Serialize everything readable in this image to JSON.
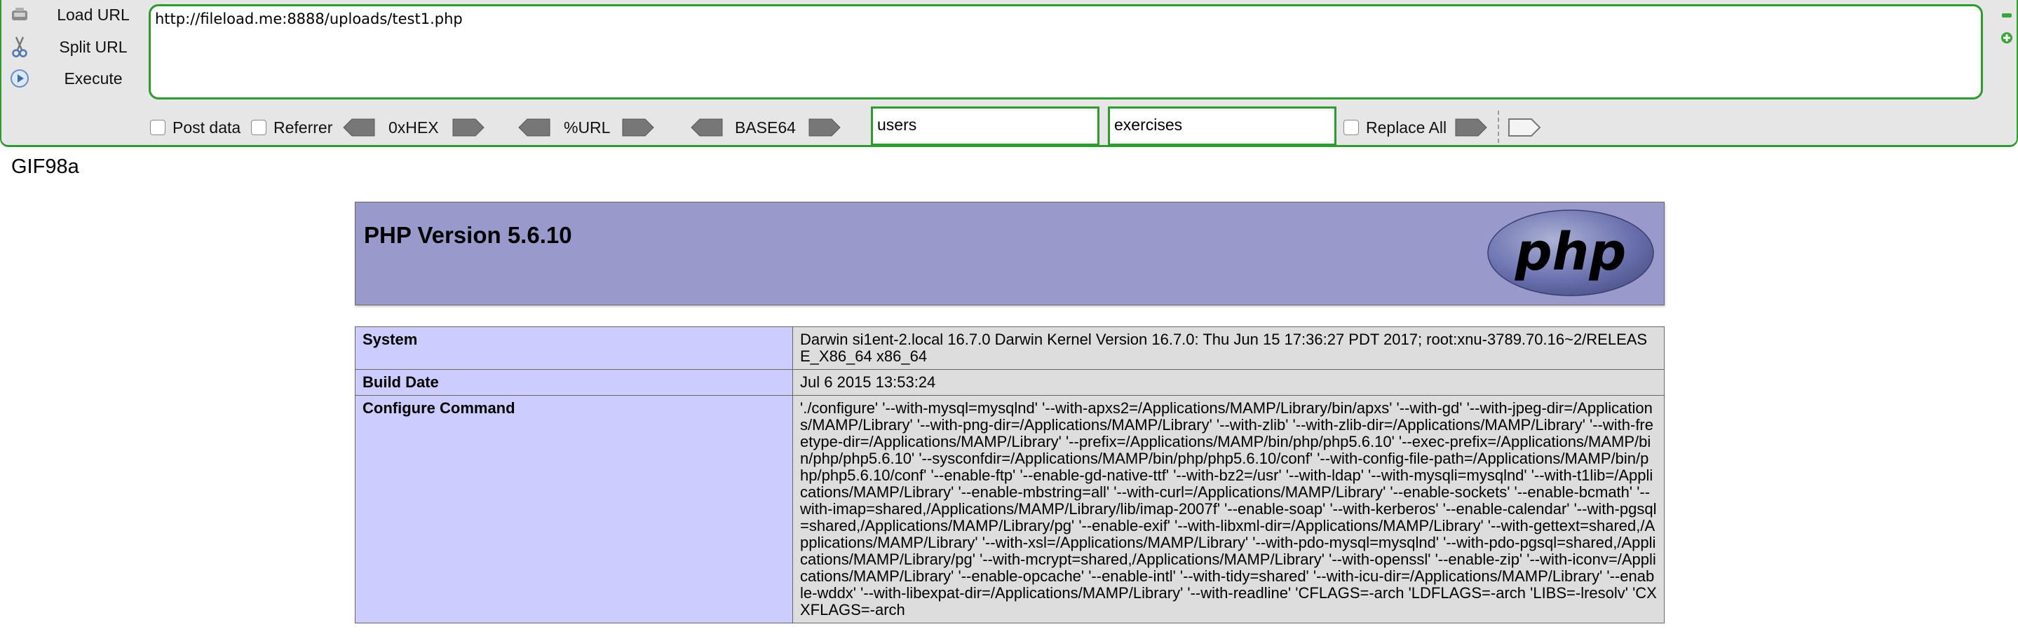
{
  "hackbar": {
    "load_url_label": "Load URL",
    "split_url_label": "Split URL",
    "execute_label": "Execute",
    "url_value": "http://fileload.me:8888/uploads/test1.php",
    "post_data_label": "Post data",
    "referrer_label": "Referrer",
    "hex_label": "0xHEX",
    "url_enc_label": "%URL",
    "base64_label": "BASE64",
    "replace_find_value": "users",
    "replace_with_value": "exercises",
    "replace_all_label": "Replace All",
    "accent_color": "#2f9a30"
  },
  "page": {
    "gif_header": "GIF98a",
    "php_title": "PHP Version 5.6.10",
    "logo_text": "php",
    "rows": [
      {
        "key": "System",
        "value": "Darwin si1ent-2.local 16.7.0 Darwin Kernel Version 16.7.0: Thu Jun 15 17:36:27 PDT 2017; root:xnu-3789.70.16~2/RELEASE_X86_64 x86_64"
      },
      {
        "key": "Build Date",
        "value": "Jul 6 2015 13:53:24"
      },
      {
        "key": "Configure Command",
        "value": "'./configure' '--with-mysql=mysqlnd' '--with-apxs2=/Applications/MAMP/Library/bin/apxs' '--with-gd' '--with-jpeg-dir=/Applications/MAMP/Library' '--with-png-dir=/Applications/MAMP/Library' '--with-zlib' '--with-zlib-dir=/Applications/MAMP/Library' '--with-freetype-dir=/Applications/MAMP/Library' '--prefix=/Applications/MAMP/bin/php/php5.6.10' '--exec-prefix=/Applications/MAMP/bin/php/php5.6.10' '--sysconfdir=/Applications/MAMP/bin/php/php5.6.10/conf' '--with-config-file-path=/Applications/MAMP/bin/php/php5.6.10/conf' '--enable-ftp' '--enable-gd-native-ttf' '--with-bz2=/usr' '--with-ldap' '--with-mysqli=mysqlnd' '--with-t1lib=/Applications/MAMP/Library' '--enable-mbstring=all' '--with-curl=/Applications/MAMP/Library' '--enable-sockets' '--enable-bcmath' '--with-imap=shared,/Applications/MAMP/Library/lib/imap-2007f' '--enable-soap' '--with-kerberos' '--enable-calendar' '--with-pgsql=shared,/Applications/MAMP/Library/pg' '--enable-exif' '--with-libxml-dir=/Applications/MAMP/Library' '--with-gettext=shared,/Applications/MAMP/Library' '--with-xsl=/Applications/MAMP/Library' '--with-pdo-mysql=mysqlnd' '--with-pdo-pgsql=shared,/Applications/MAMP/Library/pg' '--with-mcrypt=shared,/Applications/MAMP/Library' '--with-openssl' '--enable-zip' '--with-iconv=/Applications/MAMP/Library' '--enable-opcache' '--enable-intl' '--with-tidy=shared' '--with-icu-dir=/Applications/MAMP/Library' '--enable-wddx' '--with-libexpat-dir=/Applications/MAMP/Library' '--with-readline' 'CFLAGS=-arch 'LDFLAGS=-arch 'LIBS=-lresolv' 'CXXFLAGS=-arch"
      }
    ],
    "header_color": "#9999cc",
    "key_cell_color": "#ccccff",
    "value_cell_color": "#dddddd"
  }
}
